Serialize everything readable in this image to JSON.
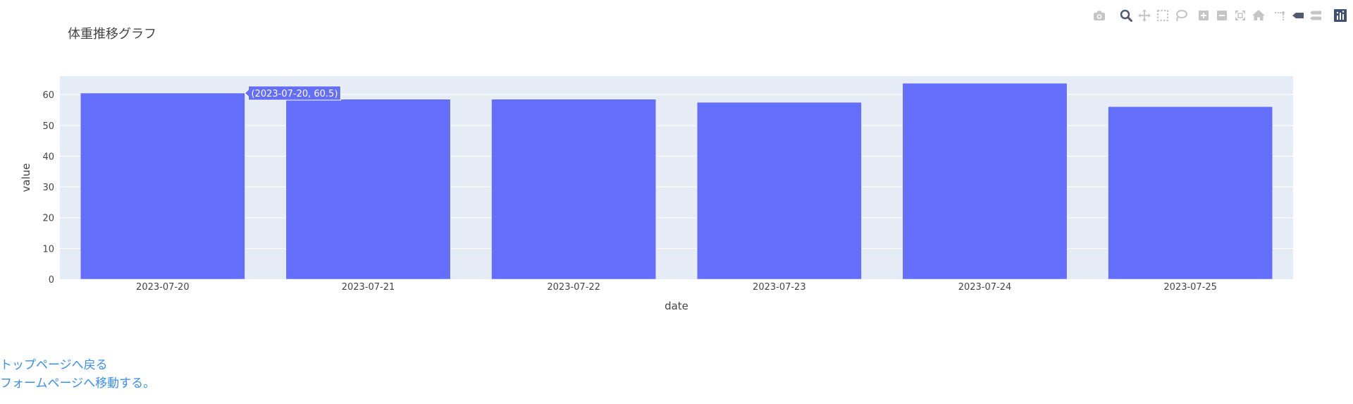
{
  "chart_data": {
    "type": "bar",
    "title": "体重推移グラフ",
    "xlabel": "date",
    "ylabel": "value",
    "categories": [
      "2023-07-20",
      "2023-07-21",
      "2023-07-22",
      "2023-07-23",
      "2023-07-24",
      "2023-07-25"
    ],
    "values": [
      60.5,
      58.5,
      58.5,
      57.5,
      63.7,
      56.1
    ],
    "ylim": [
      0,
      66
    ],
    "yticks": [
      0,
      10,
      20,
      30,
      40,
      50,
      60
    ],
    "grid": true,
    "bar_color": "#636efa",
    "plot_bg": "#e5ecf6",
    "hover": {
      "category_index": 0,
      "label": "(2023-07-20, 60.5)"
    }
  },
  "modebar": {
    "icons": [
      "camera-icon",
      "zoom-icon",
      "pan-icon",
      "box-select-icon",
      "lasso-select-icon",
      "zoom-in-icon",
      "zoom-out-icon",
      "autoscale-icon",
      "reset-axes-icon",
      "spike-lines-icon",
      "hover-closest-icon",
      "hover-compare-icon",
      "plotly-logo-icon"
    ]
  },
  "links": {
    "top_page": "トップページへ戻る",
    "form_page": "フォームページへ移動する。"
  }
}
